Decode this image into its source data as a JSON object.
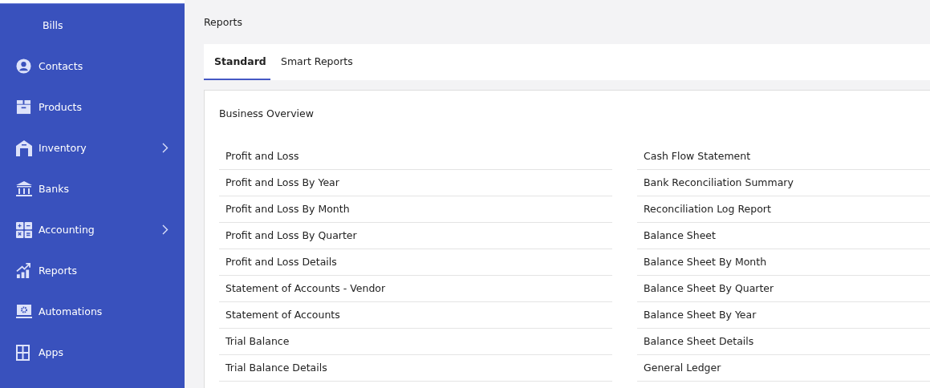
{
  "sidebar": {
    "items": [
      {
        "label": "Bills",
        "expandable": false
      },
      {
        "label": "Contacts",
        "expandable": false
      },
      {
        "label": "Products",
        "expandable": false
      },
      {
        "label": "Inventory",
        "expandable": true
      },
      {
        "label": "Banks",
        "expandable": false
      },
      {
        "label": "Accounting",
        "expandable": true
      },
      {
        "label": "Reports",
        "expandable": false
      },
      {
        "label": "Automations",
        "expandable": false
      },
      {
        "label": "Apps",
        "expandable": false
      }
    ]
  },
  "page_title": "Reports",
  "tabs": [
    {
      "label": "Standard",
      "selected": true
    },
    {
      "label": "Smart Reports",
      "selected": false
    }
  ],
  "section": {
    "title": "Business Overview",
    "left_reports": [
      "Profit and Loss",
      "Profit and Loss By Year",
      "Profit and Loss By Month",
      "Profit and Loss By Quarter",
      "Profit and Loss Details",
      "Statement of Accounts - Vendor",
      "Statement of Accounts",
      "Trial Balance",
      "Trial Balance Details"
    ],
    "right_reports": [
      "Cash Flow Statement",
      "Bank Reconciliation Summary",
      "Reconciliation Log Report",
      "Balance Sheet",
      "Balance Sheet By Month",
      "Balance Sheet By Quarter",
      "Balance Sheet By Year",
      "Balance Sheet Details",
      "General Ledger"
    ]
  }
}
